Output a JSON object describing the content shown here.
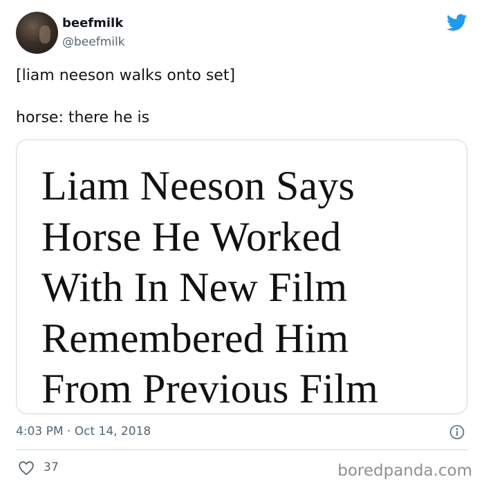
{
  "author": {
    "display_name": "beefmilk",
    "handle": "@beefmilk",
    "avatar_icon": "profile-photo"
  },
  "tweet": {
    "lines": [
      "[liam neeson walks onto set]",
      "horse: there he is"
    ]
  },
  "card": {
    "headline_lines": [
      "Liam Neeson Says",
      "Horse He Worked",
      "With In New Film",
      "Remembered Him",
      "From Previous Film"
    ]
  },
  "meta": {
    "time": "4:03 PM",
    "separator": "·",
    "date": "Oct 14, 2018"
  },
  "engagement": {
    "likes": "37"
  },
  "watermark": "boredpanda.com",
  "colors": {
    "twitter_blue": "#1d9bf0",
    "secondary_text": "#536471",
    "divider": "#cfd9de"
  }
}
